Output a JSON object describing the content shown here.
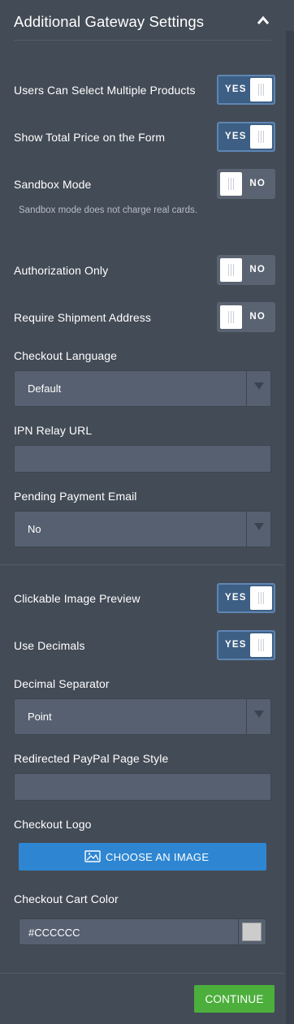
{
  "header": {
    "title": "Additional Gateway Settings"
  },
  "settings": {
    "multiple_products": {
      "label": "Users Can Select Multiple Products",
      "state": "YES"
    },
    "total_price": {
      "label": "Show Total Price on the Form",
      "state": "YES"
    },
    "sandbox": {
      "label": "Sandbox Mode",
      "state": "NO",
      "helper": "Sandbox mode does not charge real cards."
    },
    "auth_only": {
      "label": "Authorization Only",
      "state": "NO"
    },
    "shipment": {
      "label": "Require Shipment Address",
      "state": "NO"
    },
    "checkout_language": {
      "label": "Checkout Language",
      "value": "Default"
    },
    "ipn_relay": {
      "label": "IPN Relay URL",
      "value": ""
    },
    "pending_email": {
      "label": "Pending Payment Email",
      "value": "No"
    },
    "image_preview": {
      "label": "Clickable Image Preview",
      "state": "YES"
    },
    "use_decimals": {
      "label": "Use Decimals",
      "state": "YES"
    },
    "decimal_separator": {
      "label": "Decimal Separator",
      "value": "Point"
    },
    "page_style": {
      "label": "Redirected PayPal Page Style",
      "value": ""
    },
    "checkout_logo": {
      "label": "Checkout Logo",
      "button": "CHOOSE AN IMAGE"
    },
    "cart_color": {
      "label": "Checkout Cart Color",
      "value": "#CCCCCC",
      "swatch": "#cccccc"
    }
  },
  "footer": {
    "continue_label": "CONTINUE"
  },
  "colors": {
    "background": "#434b56",
    "toggle_on": "#3e5f84",
    "toggle_off": "#5a6371",
    "primary_button": "#2e86d2",
    "continue_button": "#4caf3c"
  }
}
